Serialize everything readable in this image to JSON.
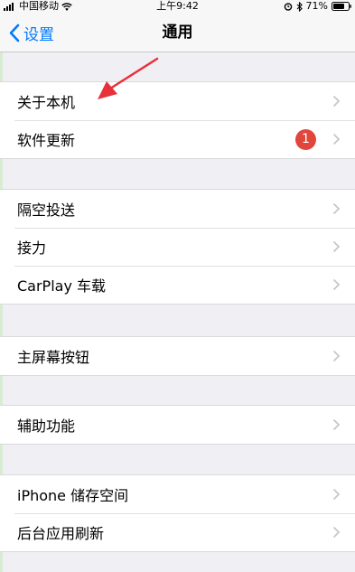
{
  "status_bar": {
    "carrier": "中国移动",
    "time": "上午9:42",
    "battery": "71%"
  },
  "nav": {
    "back_label": "设置",
    "title": "通用"
  },
  "groups": [
    {
      "rows": [
        {
          "label": "关于本机"
        },
        {
          "label": "软件更新",
          "badge": "1"
        }
      ]
    },
    {
      "rows": [
        {
          "label": "隔空投送"
        },
        {
          "label": "接力"
        },
        {
          "label": "CarPlay 车载"
        }
      ]
    },
    {
      "rows": [
        {
          "label": "主屏幕按钮"
        }
      ]
    },
    {
      "rows": [
        {
          "label": "辅助功能"
        }
      ]
    },
    {
      "rows": [
        {
          "label": "iPhone 储存空间"
        },
        {
          "label": "后台应用刷新"
        }
      ]
    }
  ],
  "colors": {
    "accent": "#007aff",
    "badge": "#e0463c",
    "annotation_arrow": "#e8303a",
    "background": "#efeff4"
  }
}
